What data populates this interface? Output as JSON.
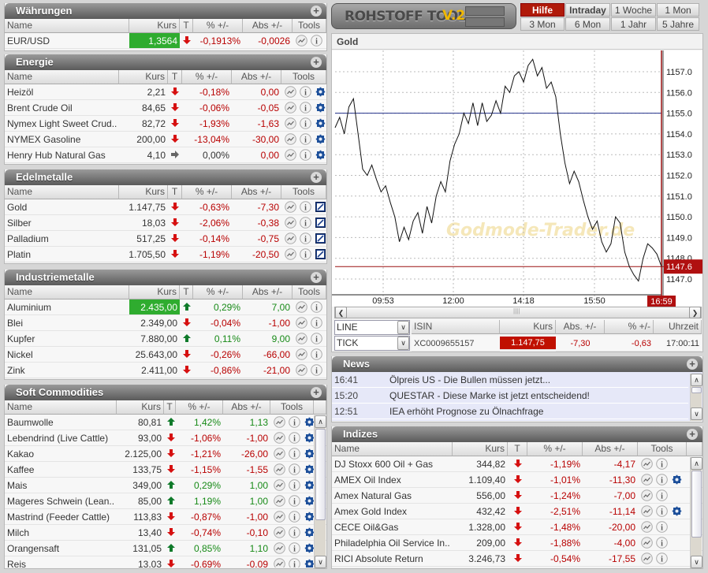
{
  "common": {
    "cols": [
      "Name",
      "Kurs",
      "T",
      "% +/-",
      "Abs +/-",
      "Tools"
    ]
  },
  "waehrungen": {
    "title": "Währungen",
    "rows": [
      {
        "name": "EUR/USD",
        "kurs": "1,3564",
        "trend": "down",
        "pct": "-0,1913%",
        "abs": "-0,0026",
        "tools": [
          "chart",
          "info"
        ],
        "hl": true
      }
    ]
  },
  "energie": {
    "title": "Energie",
    "rows": [
      {
        "name": "Heizöl",
        "kurs": "2,21",
        "trend": "down",
        "pct": "-0,18%",
        "abs": "0,00",
        "tools": [
          "chart",
          "info",
          "gear"
        ]
      },
      {
        "name": "Brent Crude Oil",
        "kurs": "84,65",
        "trend": "down",
        "pct": "-0,06%",
        "abs": "-0,05",
        "tools": [
          "chart",
          "info",
          "gear"
        ]
      },
      {
        "name": "Nymex Light Sweet Crud..",
        "kurs": "82,72",
        "trend": "down",
        "pct": "-1,93%",
        "abs": "-1,63",
        "tools": [
          "chart",
          "info",
          "gear"
        ]
      },
      {
        "name": "NYMEX Gasoline",
        "kurs": "200,00",
        "trend": "down",
        "pct": "-13,04%",
        "abs": "-30,00",
        "tools": [
          "chart",
          "info",
          "gear"
        ]
      },
      {
        "name": "Henry Hub Natural Gas",
        "kurs": "4,10",
        "trend": "flat",
        "pct": "0,00%",
        "abs": "0,00",
        "tools": [
          "chart",
          "info",
          "gear"
        ]
      }
    ]
  },
  "edelmetalle": {
    "title": "Edelmetalle",
    "rows": [
      {
        "name": "Gold",
        "kurs": "1.147,75",
        "trend": "down",
        "pct": "-0,63%",
        "abs": "-7,30",
        "tools": [
          "chart",
          "info",
          "edit"
        ]
      },
      {
        "name": "Silber",
        "kurs": "18,03",
        "trend": "down",
        "pct": "-2,06%",
        "abs": "-0,38",
        "tools": [
          "chart",
          "info",
          "edit"
        ]
      },
      {
        "name": "Palladium",
        "kurs": "517,25",
        "trend": "down",
        "pct": "-0,14%",
        "abs": "-0,75",
        "tools": [
          "chart",
          "info",
          "edit"
        ]
      },
      {
        "name": "Platin",
        "kurs": "1.705,50",
        "trend": "down",
        "pct": "-1,19%",
        "abs": "-20,50",
        "tools": [
          "chart",
          "info",
          "edit"
        ]
      }
    ]
  },
  "industriemetalle": {
    "title": "Industriemetalle",
    "rows": [
      {
        "name": "Aluminium",
        "kurs": "2.435,00",
        "trend": "up",
        "pct": "0,29%",
        "abs": "7,00",
        "tools": [
          "chart",
          "info"
        ],
        "hl": true
      },
      {
        "name": "Blei",
        "kurs": "2.349,00",
        "trend": "down",
        "pct": "-0,04%",
        "abs": "-1,00",
        "tools": [
          "chart",
          "info"
        ]
      },
      {
        "name": "Kupfer",
        "kurs": "7.880,00",
        "trend": "up",
        "pct": "0,11%",
        "abs": "9,00",
        "tools": [
          "chart",
          "info"
        ]
      },
      {
        "name": "Nickel",
        "kurs": "25.643,00",
        "trend": "down",
        "pct": "-0,26%",
        "abs": "-66,00",
        "tools": [
          "chart",
          "info"
        ]
      },
      {
        "name": "Zink",
        "kurs": "2.411,00",
        "trend": "down",
        "pct": "-0,86%",
        "abs": "-21,00",
        "tools": [
          "chart",
          "info"
        ]
      }
    ]
  },
  "soft": {
    "title": "Soft Commodities",
    "rows": [
      {
        "name": "Baumwolle",
        "kurs": "80,81",
        "trend": "up",
        "pct": "1,42%",
        "abs": "1,13",
        "tools": [
          "chart",
          "info",
          "gear"
        ]
      },
      {
        "name": "Lebendrind (Live Cattle)",
        "kurs": "93,00",
        "trend": "down",
        "pct": "-1,06%",
        "abs": "-1,00",
        "tools": [
          "chart",
          "info",
          "gear"
        ]
      },
      {
        "name": "Kakao",
        "kurs": "2.125,00",
        "trend": "down",
        "pct": "-1,21%",
        "abs": "-26,00",
        "tools": [
          "chart",
          "info",
          "gear"
        ]
      },
      {
        "name": "Kaffee",
        "kurs": "133,75",
        "trend": "down",
        "pct": "-1,15%",
        "abs": "-1,55",
        "tools": [
          "chart",
          "info",
          "gear"
        ]
      },
      {
        "name": "Mais",
        "kurs": "349,00",
        "trend": "up",
        "pct": "0,29%",
        "abs": "1,00",
        "tools": [
          "chart",
          "info",
          "gear"
        ]
      },
      {
        "name": "Mageres Schwein (Lean..",
        "kurs": "85,00",
        "trend": "up",
        "pct": "1,19%",
        "abs": "1,00",
        "tools": [
          "chart",
          "info",
          "gear"
        ]
      },
      {
        "name": "Mastrind (Feeder Cattle)",
        "kurs": "113,83",
        "trend": "down",
        "pct": "-0,87%",
        "abs": "-1,00",
        "tools": [
          "chart",
          "info",
          "gear"
        ]
      },
      {
        "name": "Milch",
        "kurs": "13,40",
        "trend": "down",
        "pct": "-0,74%",
        "abs": "-0,10",
        "tools": [
          "chart",
          "info",
          "gear"
        ]
      },
      {
        "name": "Orangensaft",
        "kurs": "131,05",
        "trend": "up",
        "pct": "0,85%",
        "abs": "1,10",
        "tools": [
          "chart",
          "info",
          "gear"
        ]
      },
      {
        "name": "Reis",
        "kurs": "13,03",
        "trend": "down",
        "pct": "-0,69%",
        "abs": "-0,09",
        "tools": [
          "chart",
          "info",
          "gear"
        ]
      }
    ]
  },
  "indizes": {
    "title": "Indizes",
    "rows": [
      {
        "name": "DJ Stoxx 600 Oil + Gas",
        "kurs": "344,82",
        "trend": "down",
        "pct": "-1,19%",
        "abs": "-4,17",
        "tools": [
          "chart",
          "info"
        ]
      },
      {
        "name": "AMEX Oil Index",
        "kurs": "1.109,40",
        "trend": "down",
        "pct": "-1,01%",
        "abs": "-11,30",
        "tools": [
          "chart",
          "info",
          "gear"
        ]
      },
      {
        "name": "Amex Natural Gas",
        "kurs": "556,00",
        "trend": "down",
        "pct": "-1,24%",
        "abs": "-7,00",
        "tools": [
          "chart",
          "info"
        ]
      },
      {
        "name": "Amex Gold Index",
        "kurs": "432,42",
        "trend": "down",
        "pct": "-2,51%",
        "abs": "-11,14",
        "tools": [
          "chart",
          "info",
          "gear"
        ]
      },
      {
        "name": "CECE Oil&Gas",
        "kurs": "1.328,00",
        "trend": "down",
        "pct": "-1,48%",
        "abs": "-20,00",
        "tools": [
          "chart",
          "info"
        ]
      },
      {
        "name": "Philadelphia Oil Service In..",
        "kurs": "209,00",
        "trend": "down",
        "pct": "-1,88%",
        "abs": "-4,00",
        "tools": [
          "chart",
          "info"
        ]
      },
      {
        "name": "RICI Absolute Return",
        "kurs": "3.246,73",
        "trend": "down",
        "pct": "-0,54%",
        "abs": "-17,55",
        "tools": [
          "chart",
          "info"
        ]
      }
    ]
  },
  "logo": {
    "text": "ROHSTOFF TOOL",
    "version": "V.2"
  },
  "ranges": [
    "Hilfe",
    "Intraday",
    "1 Woche",
    "1 Mon",
    "3 Mon",
    "6 Mon",
    "1 Jahr",
    "5 Jahre"
  ],
  "chart": {
    "title": "Gold"
  },
  "chart_data": {
    "type": "line",
    "title": "Gold",
    "x_ticks": [
      "09:53",
      "12:00",
      "14:18",
      "15:50"
    ],
    "current_time": "16:59",
    "y_ticks": [
      "1147.0",
      "1148.0",
      "1149.0",
      "1150.0",
      "1151.0",
      "1152.0",
      "1153.0",
      "1154.0",
      "1155.0",
      "1156.0",
      "1157.0"
    ],
    "ylim": [
      1146.6,
      1158.0
    ],
    "reference_line": 1155.0,
    "last_price": 1147.6,
    "last_price_label": "1147.6",
    "watermark": "Godmode-Trader.de",
    "values": [
      1154.3,
      1154.8,
      1154.0,
      1155.3,
      1155.7,
      1154.0,
      1152.3,
      1152.0,
      1152.5,
      1151.8,
      1151.2,
      1151.5,
      1150.7,
      1150.0,
      1148.8,
      1149.5,
      1148.9,
      1149.8,
      1150.2,
      1149.2,
      1150.5,
      1149.7,
      1151.0,
      1151.7,
      1151.2,
      1152.7,
      1153.5,
      1154.0,
      1155.0,
      1154.5,
      1155.5,
      1154.4,
      1155.5,
      1154.6,
      1154.9,
      1155.6,
      1155.0,
      1156.3,
      1156.0,
      1156.8,
      1157.0,
      1156.5,
      1157.3,
      1157.6,
      1156.8,
      1157.2,
      1156.2,
      1156.5,
      1155.8,
      1154.0,
      1152.6,
      1151.6,
      1152.2,
      1151.7,
      1150.8,
      1150.0,
      1149.4,
      1149.8,
      1148.8,
      1148.3,
      1148.7,
      1150.0,
      1149.7,
      1148.3,
      1147.6,
      1147.2,
      1146.9,
      1148.0,
      1148.7,
      1148.5,
      1148.2,
      1147.6
    ]
  },
  "info": {
    "type_select": "LINE",
    "mode_select": "TICK",
    "headers": [
      "ISIN",
      "Kurs",
      "Abs. +/-",
      "% +/-",
      "Uhrzeit"
    ],
    "isin": "XC0009655157",
    "kurs": "1.147,75",
    "abs": "-7,30",
    "pct": "-0,63",
    "time": "17:00:11"
  },
  "news": {
    "title": "News",
    "items": [
      {
        "time": "16:41",
        "text": "Ölpreis US - Die Bullen müssen jetzt..."
      },
      {
        "time": "15:20",
        "text": "QUESTAR - Diese Marke ist jetzt entscheidend!"
      },
      {
        "time": "12:51",
        "text": "IEA erhöht Prognose zu Ölnachfrage"
      }
    ]
  },
  "colors": {
    "up": "#178a17",
    "down": "#b80000",
    "highlight": "#2fac2f",
    "accent": "#b01a0a"
  }
}
